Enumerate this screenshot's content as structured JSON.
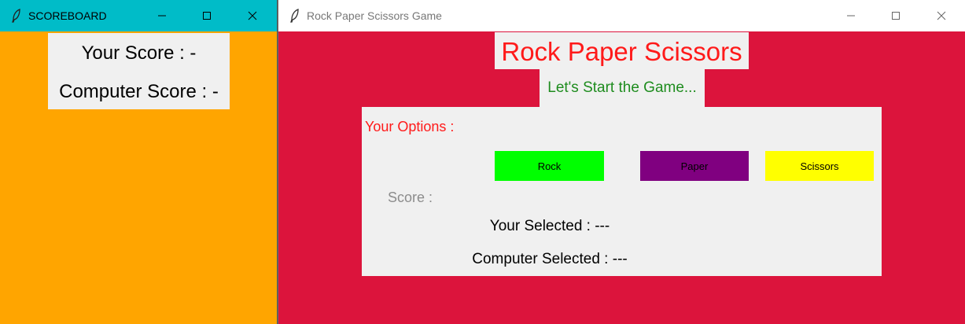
{
  "scoreboard": {
    "window_title": "SCOREBOARD",
    "your_score": "Your Score : -",
    "computer_score": "Computer Score : -",
    "colors": {
      "titlebar": "#00bcc8",
      "background": "#ffa500"
    }
  },
  "game": {
    "window_title": "Rock Paper Scissors Game",
    "heading": "Rock Paper Scissors",
    "subheading": "Let's Start the Game...",
    "options_label": "Your Options :",
    "buttons": {
      "rock": "Rock",
      "paper": "Paper",
      "scissors": "Scissors"
    },
    "button_colors": {
      "rock": "#00ff00",
      "paper": "#800080",
      "scissors": "#ffff00"
    },
    "score_label": "Score :",
    "your_selected": "Your Selected : ---",
    "computer_selected": "Computer Selected : ---",
    "colors": {
      "background": "#dc143c",
      "heading": "#ff1a1a",
      "subheading": "#1e8c1e"
    }
  }
}
